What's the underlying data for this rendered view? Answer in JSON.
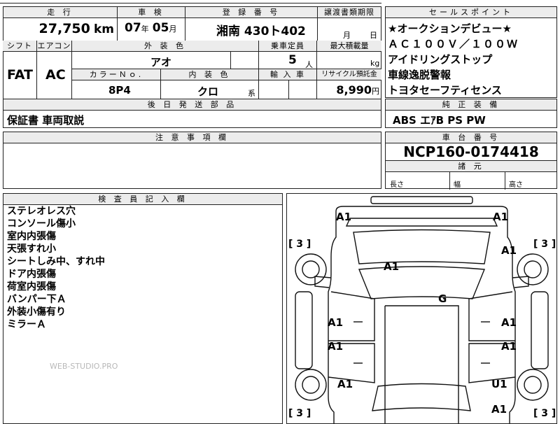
{
  "mileage_block": {
    "header": "走 行",
    "value": "27,750",
    "unit": "km"
  },
  "inspection_block": {
    "header": "車 検",
    "year": "07",
    "year_unit": "年",
    "month": "05",
    "month_unit": "月"
  },
  "registration_block": {
    "header": "登 録 番 号",
    "value": "湘南 430ト402"
  },
  "transfer_block": {
    "header": "譲渡書類期限",
    "month_unit": "月",
    "day_unit": "日"
  },
  "sales_points": {
    "header": "セールスポイント",
    "lines": [
      "★オークションデビュー★",
      "ＡＣ１００Ｖ／１００Ｗ",
      "アイドリングストップ",
      "車線逸脱警報",
      "トヨタセーフティセンス"
    ]
  },
  "shift_block": {
    "header": "シフト",
    "value": "FAT"
  },
  "aircon_block": {
    "header": "エアコン",
    "value": "AC"
  },
  "exterior_color": {
    "header": "外 装 色",
    "value": "アオ"
  },
  "capacity": {
    "header": "乗車定員",
    "value": "5",
    "unit": "人"
  },
  "max_load": {
    "header": "最大積載量",
    "unit": "kg"
  },
  "color_no": {
    "header": "カラーＮｏ.",
    "value": "8P4"
  },
  "interior_color": {
    "header": "内 装 色",
    "value": "クロ",
    "suffix": "系"
  },
  "import_block": {
    "header": "輸 入 車"
  },
  "recycle": {
    "header": "リサイクル預託金",
    "value": "8,990",
    "unit": "円"
  },
  "later_parts": {
    "header": "後 日 発 送 部 品"
  },
  "warranty": {
    "value": "保証書 車両取説"
  },
  "genuine_equipment": {
    "header": "純 正 装 備",
    "value": "ABS エｱB PS PW"
  },
  "caution": {
    "header": "注 意 事 項 欄"
  },
  "chassis": {
    "header": "車 台 番 号",
    "value": "NCP160-0174418"
  },
  "dimensions": {
    "header": "諸 元",
    "length_label": "長さ",
    "width_label": "幅",
    "height_label": "高さ"
  },
  "inspector_notes": {
    "header": "検 査 員 記 入 欄",
    "lines": [
      "ステレオレス穴",
      "コンソール傷小",
      "室内内張傷",
      "天張すれ小",
      "シートしみ中、すれ中",
      "ドア内張傷",
      "荷室内張傷",
      "バンパー下Ａ",
      "外装小傷有り",
      "ミラーＡ"
    ]
  },
  "watermark": "WEB-STUDIO.PRO",
  "diagram_marks": {
    "front_left": "A1",
    "front_right": "A1",
    "left_tire_front": "[ 3 ]",
    "right_tire_front": "[ 3 ]",
    "right_mirror": "A1",
    "hood": "A1",
    "windshield": "G",
    "left_front_door": "A1",
    "right_front_door": "A1",
    "left_rear_door": "A1",
    "right_rear_door": "A1",
    "left_rear": "A1",
    "right_rear_u": "U1",
    "rear_bumper": "A1",
    "left_tire_rear": "[ 3 ]",
    "right_tire_rear": "[ 3 ]"
  }
}
